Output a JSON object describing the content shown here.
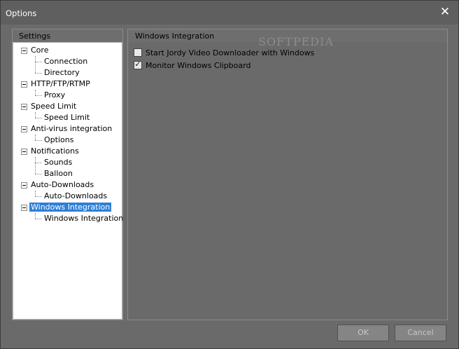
{
  "window": {
    "title": "Options"
  },
  "settings": {
    "header": "Settings",
    "tree": [
      {
        "label": "Core",
        "children": [
          "Connection",
          "Directory"
        ]
      },
      {
        "label": "HTTP/FTP/RTMP",
        "children": [
          "Proxy"
        ]
      },
      {
        "label": "Speed Limit",
        "children": [
          "Speed Limit"
        ]
      },
      {
        "label": "Anti-virus integration",
        "children": [
          "Options"
        ]
      },
      {
        "label": "Notifications",
        "children": [
          "Sounds",
          "Balloon"
        ]
      },
      {
        "label": "Auto-Downloads",
        "children": [
          "Auto-Downloads"
        ]
      },
      {
        "label": "Windows Integration",
        "children": [
          "Windows Integration"
        ],
        "selected": true
      }
    ]
  },
  "panel": {
    "header": "Windows Integration",
    "watermark": "SOFTPEDIA",
    "options": [
      {
        "label": "Start Jordy Video Downloader with Windows",
        "checked": false
      },
      {
        "label": "Monitor Windows Clipboard",
        "checked": true
      }
    ]
  },
  "buttons": {
    "ok": "OK",
    "cancel": "Cancel"
  }
}
